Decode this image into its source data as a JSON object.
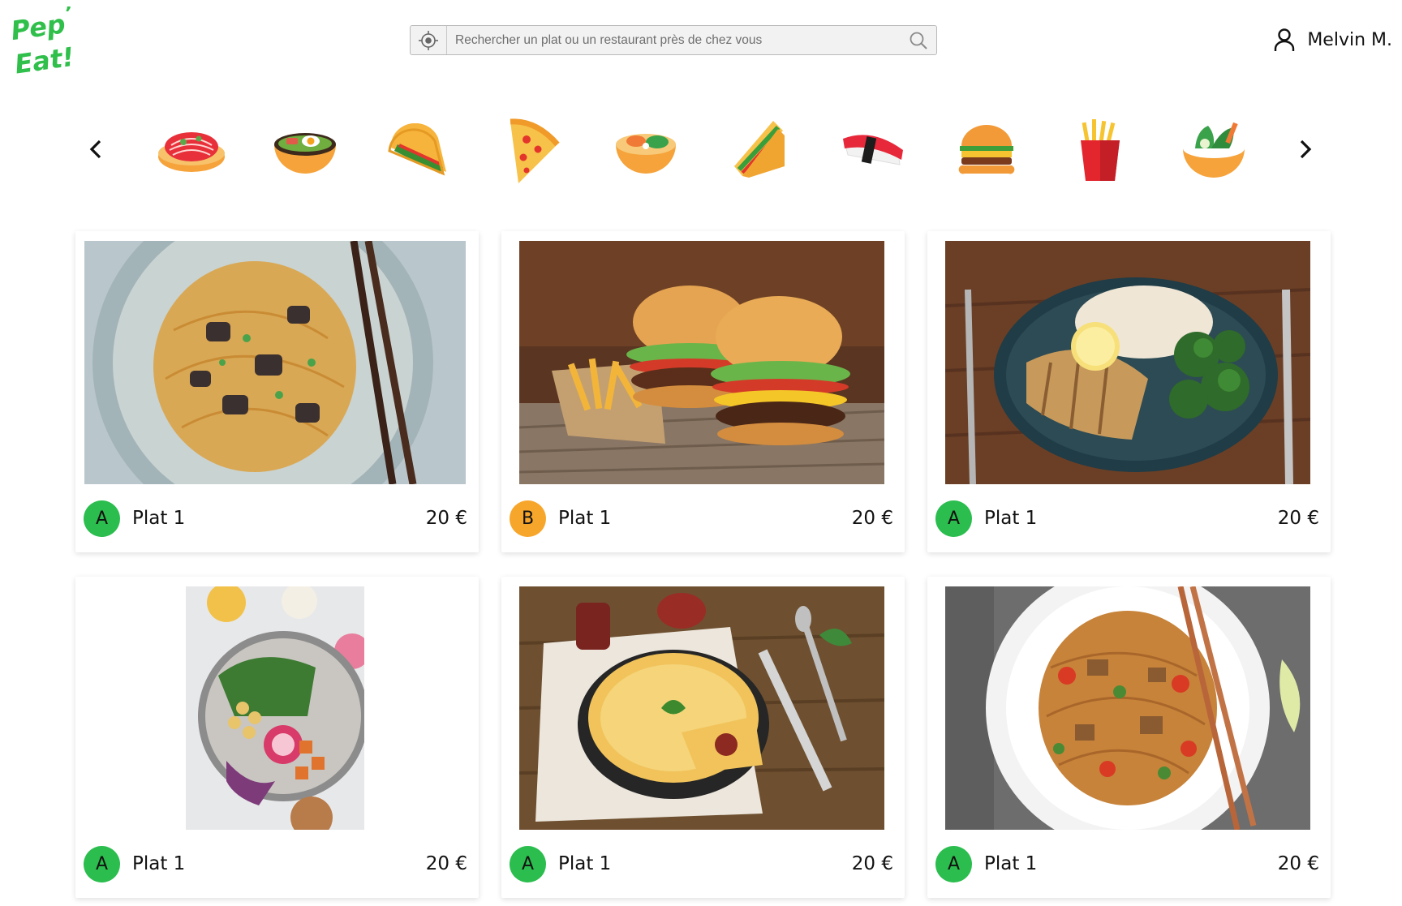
{
  "logo": {
    "text": "Pep' Eat!",
    "color": "#2fbf4a"
  },
  "search": {
    "placeholder": "Rechercher un plat ou un restaurant près de chez vous",
    "value": ""
  },
  "user": {
    "name": "Melvin M."
  },
  "categories": [
    {
      "icon": "spaghetti-icon"
    },
    {
      "icon": "ramen-icon"
    },
    {
      "icon": "taco-icon"
    },
    {
      "icon": "pizza-icon"
    },
    {
      "icon": "poke-bowl-icon"
    },
    {
      "icon": "sandwich-icon"
    },
    {
      "icon": "sushi-icon"
    },
    {
      "icon": "burger-icon"
    },
    {
      "icon": "fries-icon"
    },
    {
      "icon": "salad-icon"
    }
  ],
  "grade_colors": {
    "A": "#2bbd4e",
    "B": "#f7a62c"
  },
  "dishes": [
    {
      "grade": "A",
      "name": "Plat 1",
      "price": "20 €",
      "image": "noodles-eggplant"
    },
    {
      "grade": "B",
      "name": "Plat 1",
      "price": "20 €",
      "image": "burgers-fries"
    },
    {
      "grade": "A",
      "name": "Plat 1",
      "price": "20 €",
      "image": "chicken-broccoli"
    },
    {
      "grade": "A",
      "name": "Plat 1",
      "price": "20 €",
      "image": "buddha-bowl"
    },
    {
      "grade": "A",
      "name": "Plat 1",
      "price": "20 €",
      "image": "quiche"
    },
    {
      "grade": "A",
      "name": "Plat 1",
      "price": "20 €",
      "image": "noodles-tofu"
    }
  ]
}
